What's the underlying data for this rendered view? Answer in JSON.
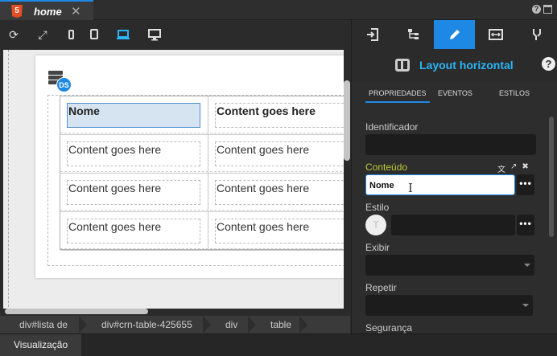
{
  "tab": {
    "icon": "html5-icon",
    "title": "home",
    "close": "✕"
  },
  "window_icons": {
    "help": "?"
  },
  "toolbar": {
    "icons": [
      "refresh-icon",
      "expand-icon",
      "phone-portrait-icon",
      "tablet-portrait-icon",
      "laptop-icon",
      "desktop-icon"
    ],
    "active": "laptop-icon"
  },
  "canvas": {
    "ds_badge": "DS",
    "table": {
      "rows": [
        [
          "Nome",
          "Content goes here"
        ],
        [
          "Content goes here",
          "Content goes here"
        ],
        [
          "Content goes here",
          "Content goes here"
        ],
        [
          "Content goes here",
          "Content goes here"
        ]
      ]
    }
  },
  "breadcrumb": [
    "div#lista de",
    "div#crn-table-425655",
    "div",
    "table"
  ],
  "status": {
    "tab_label": "Visualização"
  },
  "panel": {
    "top_tabs": [
      "insert-icon",
      "tree-icon",
      "pencil-icon",
      "resize-icon",
      "wand-icon"
    ],
    "active_tab": "pencil-icon",
    "header_title": "Layout horizontal",
    "help": "?",
    "subtabs": [
      "PROPRIEDADES",
      "EVENTOS",
      "ESTILOS"
    ],
    "fields": {
      "identificador": {
        "label": "Identificador",
        "value": ""
      },
      "conteudo": {
        "label": "Conteúdo",
        "value": "Nome"
      },
      "estilo": {
        "label": "Estilo",
        "avatar": "T",
        "value": ""
      },
      "exibir": {
        "label": "Exibir",
        "value": ""
      },
      "repetir": {
        "label": "Repetir",
        "value": ""
      },
      "seguranca": {
        "label": "Segurança"
      }
    },
    "more_label": "•••"
  },
  "colors": {
    "accent": "#1e88e5",
    "title": "#29b6f6",
    "content_label": "#c0ca33"
  }
}
